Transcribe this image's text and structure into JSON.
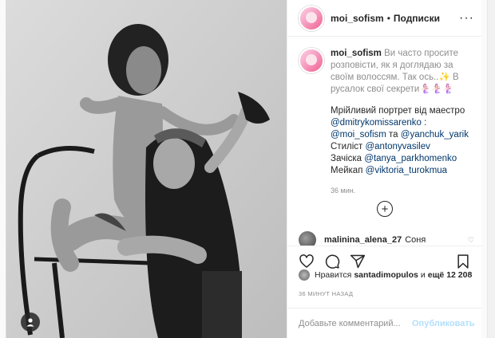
{
  "post": {
    "username": "moi_sofism",
    "follow_label": "Подписки",
    "separator": "•",
    "more_label": "···"
  },
  "caption": {
    "username": "moi_sofism",
    "text": "Ви часто просите розповісти, як я доглядаю за своїм волоссям. Так ось..✨ В русалок свої секрети🧜🏻‍♀️🧜🏻‍♀️🧜🏻‍♀️",
    "credits_intro": "Мрійливий портрет від маестро",
    "photographer": "@dmitrykomissarenko",
    "photographer_suffix": " :",
    "mention_2": "@moi_sofism",
    "and_word": " та ",
    "mention_3": "@yanchuk_yarik",
    "stylist_label": "Стиліст ",
    "stylist": "@antonyvasilev",
    "hair_label": "Зачіска ",
    "hair": "@tanya_parkhomenko",
    "makeup_label": "Мейкап ",
    "makeup": "@viktoria_turokmua",
    "time": "36 мин."
  },
  "load_more_label": "+",
  "comment": {
    "username": "malinina_alena_27",
    "text": "Соня"
  },
  "likes": {
    "prefix": "Нравится",
    "user": "santadimopulos",
    "suffix_and": "и",
    "more": "ещё 12 208"
  },
  "timestamp": "36 МИНУТ НАЗАД",
  "add_comment": {
    "placeholder": "Добавьте комментарий...",
    "publish_label": "Опубликовать"
  },
  "colors": {
    "link": "#00376b",
    "publish_disabled": "#b2dffc",
    "secondary_text": "#8e8e8e"
  }
}
